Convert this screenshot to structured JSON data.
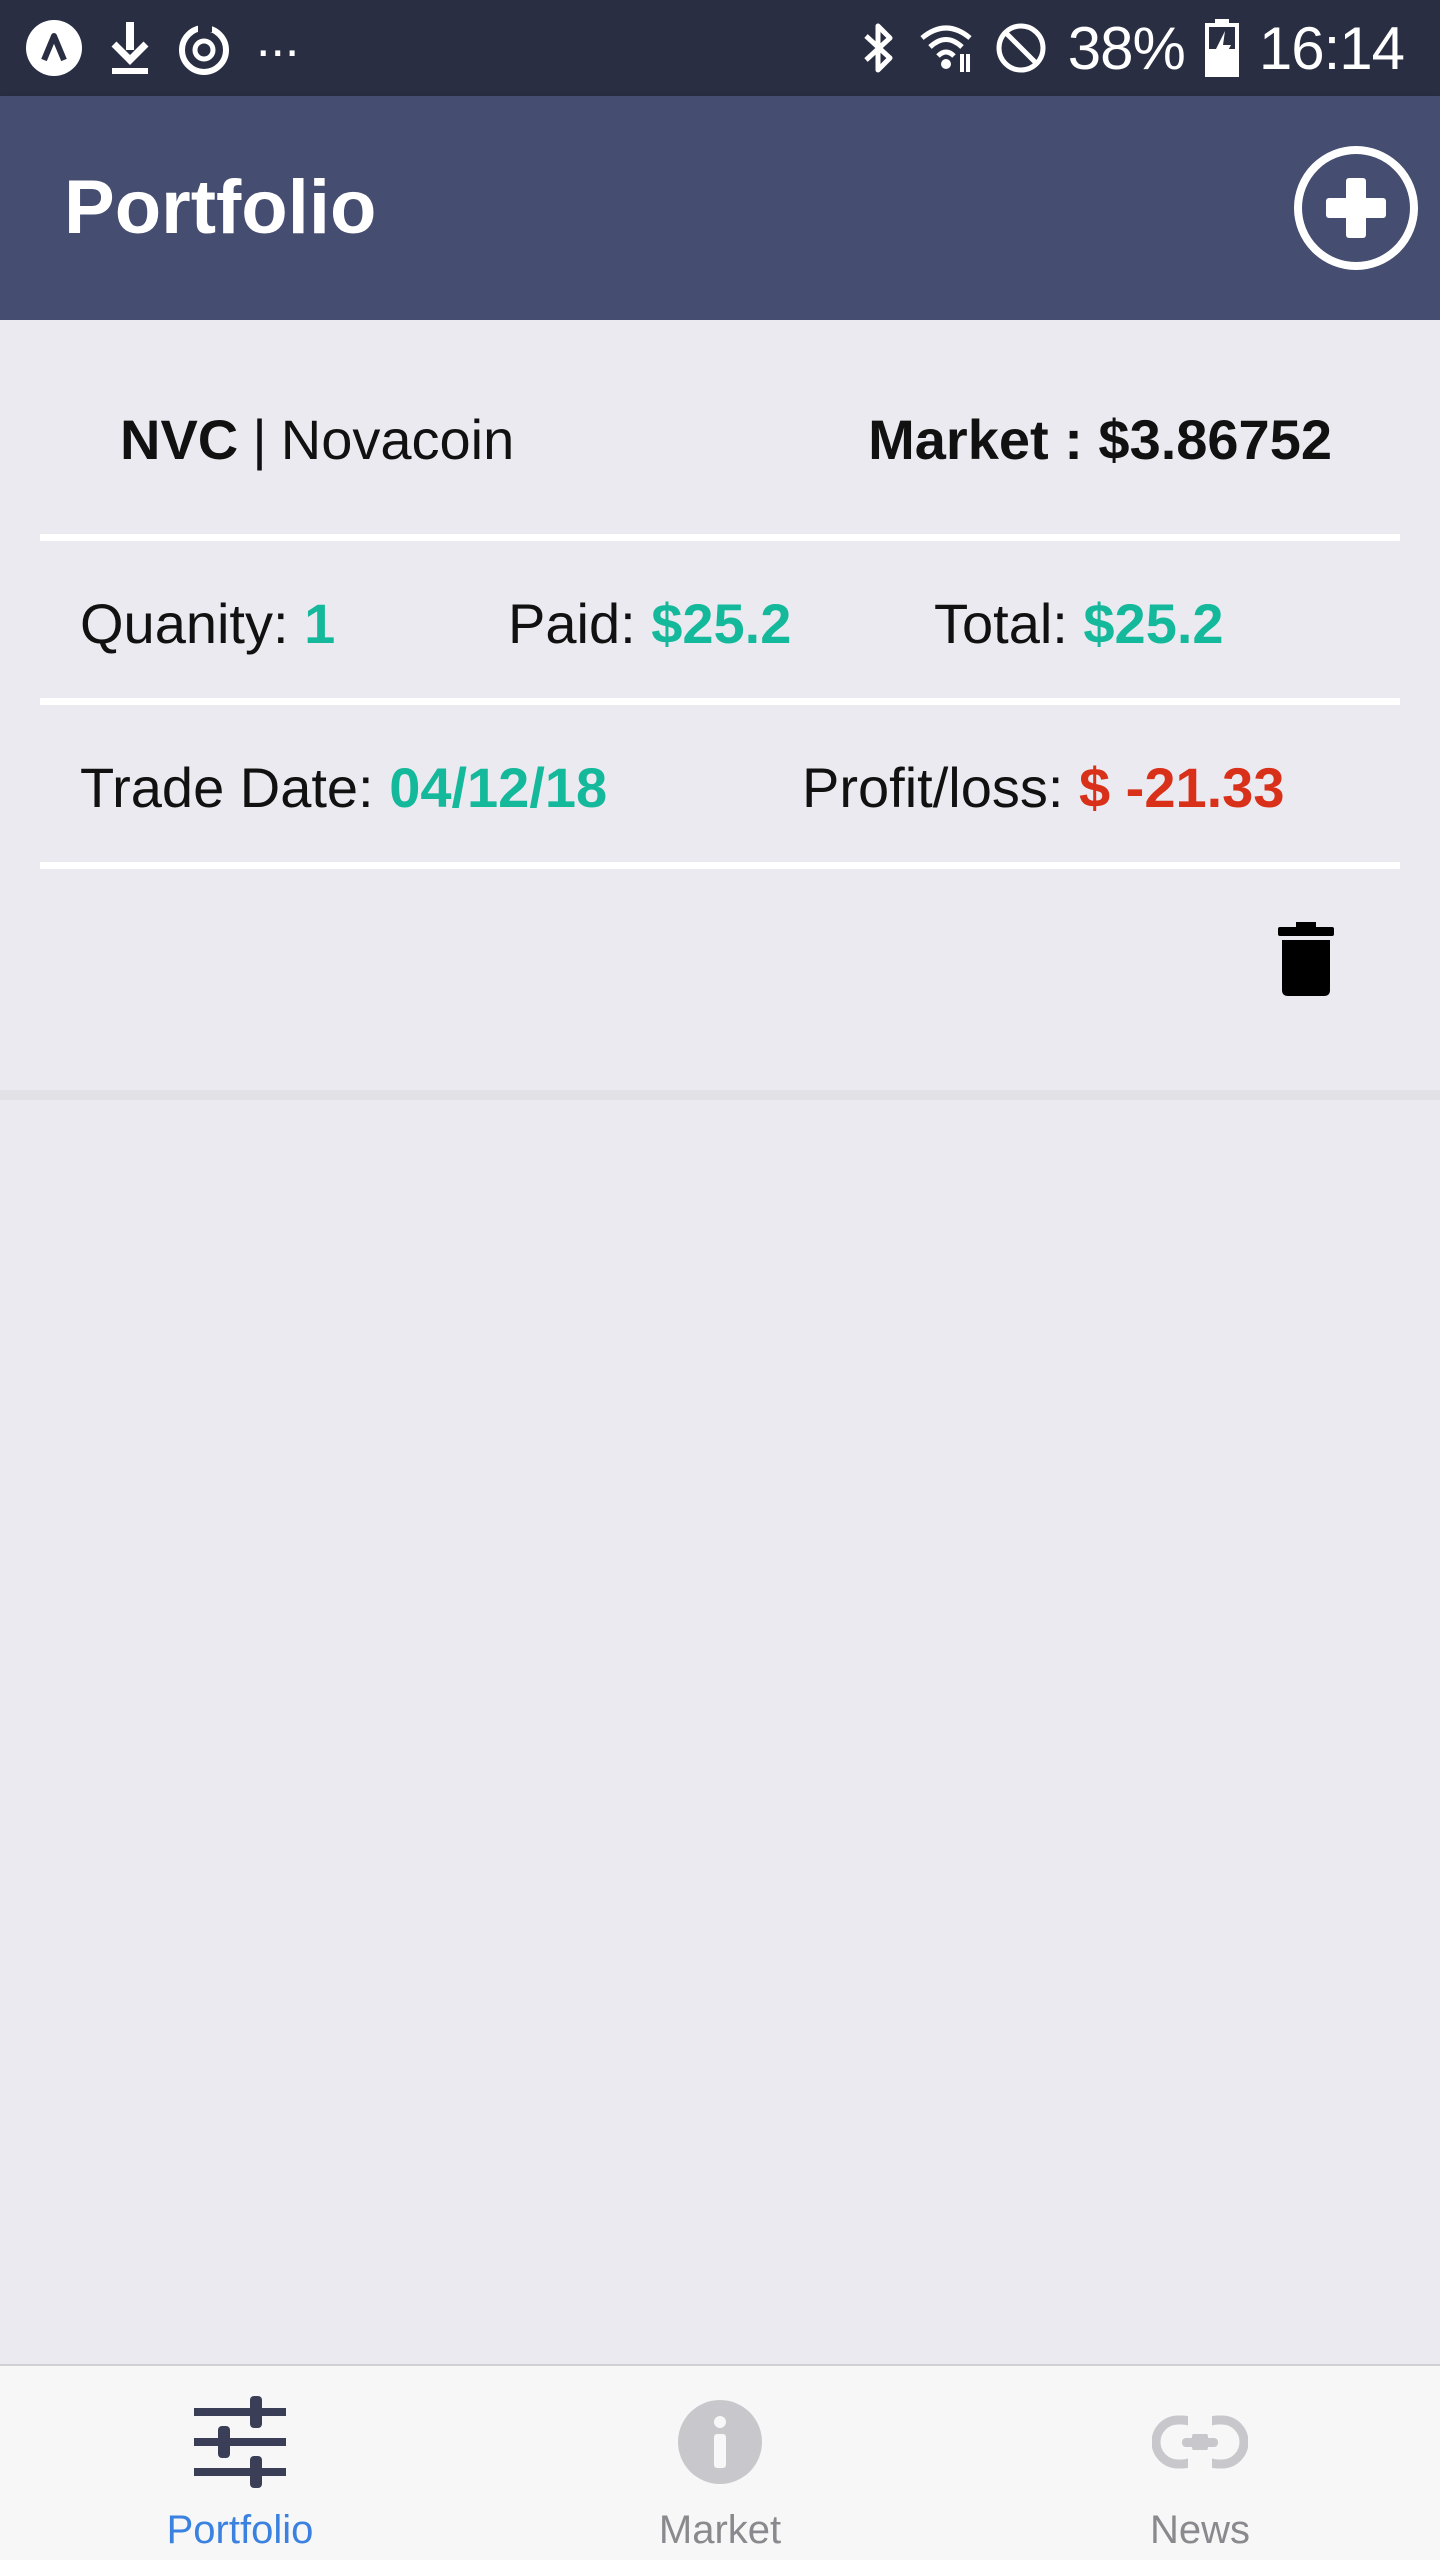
{
  "status_bar": {
    "battery": "38%",
    "time": "16:14",
    "dots": "...",
    "icons": [
      "app-notification-icon",
      "download-icon",
      "sync-icon",
      "bluetooth-icon",
      "wifi-icon",
      "do-not-disturb-icon",
      "battery-charging-icon"
    ]
  },
  "header": {
    "title": "Portfolio",
    "add_icon": "plus-circle-icon"
  },
  "holding": {
    "symbol": "NVC",
    "separator": "|",
    "name": "Novacoin",
    "market_label": "Market : ",
    "market_value": "$3.86752",
    "quantity_label": "Quanity: ",
    "quantity_value": "1",
    "paid_label": "Paid: ",
    "paid_value": "$25.2",
    "total_label": "Total: ",
    "total_value": "$25.2",
    "trade_date_label": "Trade Date: ",
    "trade_date_value": "04/12/18",
    "profit_label": "Profit/loss: ",
    "profit_value": "$ -21.33",
    "delete_icon": "trash-icon"
  },
  "tabs": [
    {
      "label": "Portfolio",
      "icon": "sliders-icon",
      "active": true
    },
    {
      "label": "Market",
      "icon": "info-icon",
      "active": false
    },
    {
      "label": "News",
      "icon": "link-icon",
      "active": false
    }
  ],
  "colors": {
    "status_bar": "#2a2e42",
    "header": "#454d70",
    "background": "#ebeaf0",
    "positive": "#14b89a",
    "negative": "#d9301a",
    "tab_active": "#3b82e0",
    "tab_inactive": "#8a8a8e"
  }
}
